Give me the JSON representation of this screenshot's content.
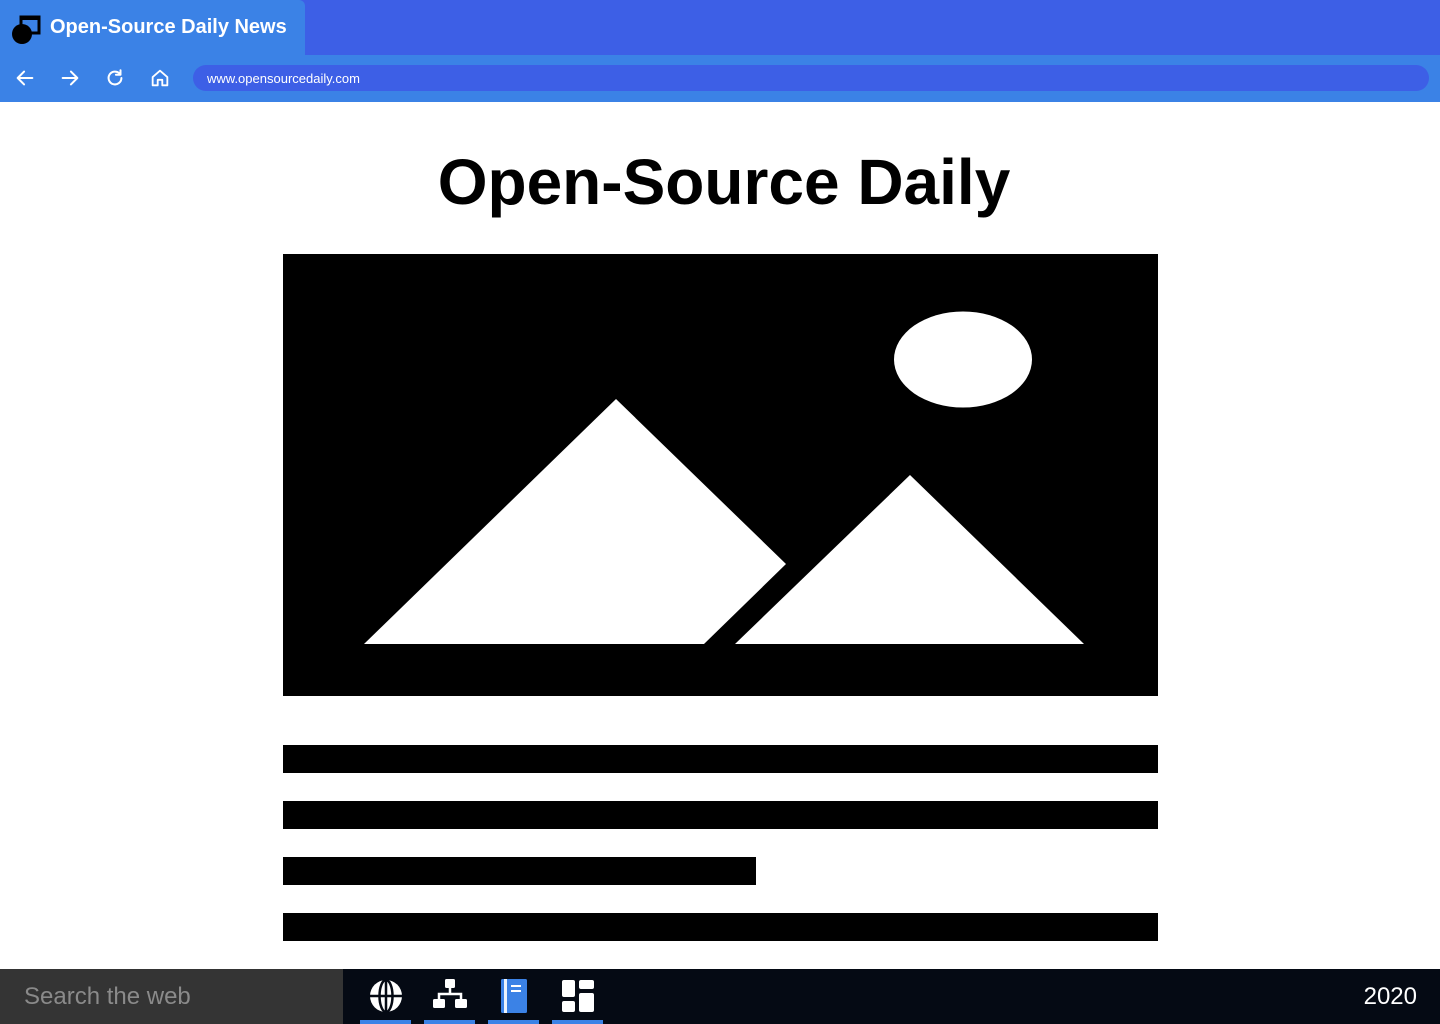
{
  "browser": {
    "tab": {
      "title": "Open-Source Daily News",
      "icon": "window-restore-icon"
    },
    "nav": {
      "back_icon": "arrow-left-icon",
      "forward_icon": "arrow-right-icon",
      "reload_icon": "reload-icon",
      "home_icon": "home-icon"
    },
    "address_url": "www.opensourcedaily.com"
  },
  "page": {
    "site_title": "Open-Source Daily",
    "hero_image_icon": "image-placeholder-icon",
    "text_line_fills": [
      1,
      1,
      0.54,
      1
    ]
  },
  "taskbar": {
    "search_placeholder": "Search the web",
    "apps": [
      {
        "icon": "globe-icon"
      },
      {
        "icon": "sitemap-icon"
      },
      {
        "icon": "notebook-icon"
      },
      {
        "icon": "dashboard-icon"
      }
    ],
    "clock": "2020"
  },
  "colors": {
    "tabstrip": "#3d5fe6",
    "toolbar": "#3b82e6",
    "taskbar": "#050a14",
    "search_box": "#343434",
    "accent": "#3b82e6"
  }
}
